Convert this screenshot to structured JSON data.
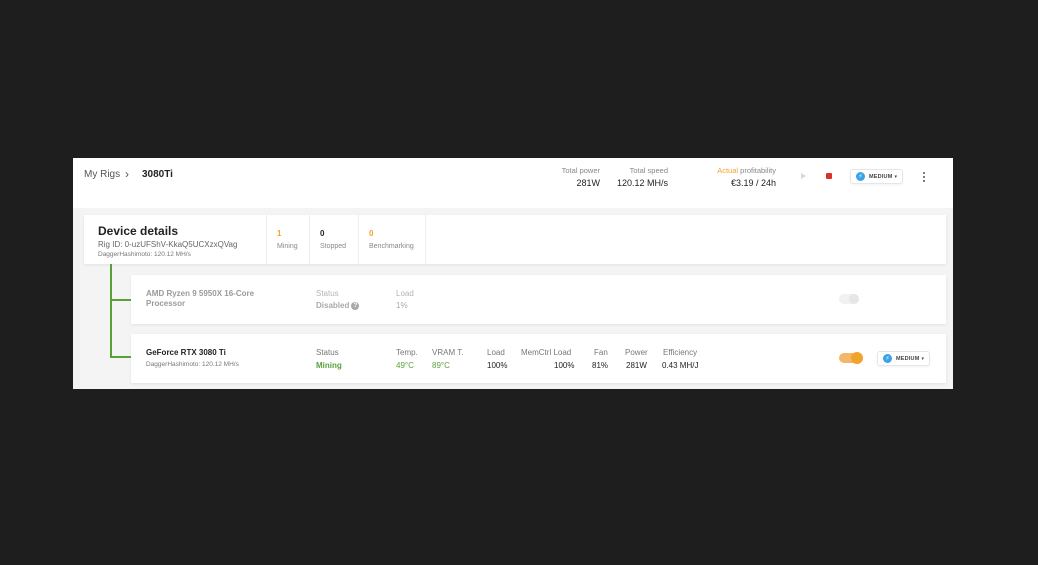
{
  "breadcrumb": {
    "parent": "My Rigs",
    "separator": "›",
    "current": "3080Ti"
  },
  "header_stats": {
    "total_power": {
      "label": "Total power",
      "value": "281W"
    },
    "total_speed": {
      "label": "Total speed",
      "value": "120.12 MH/s"
    },
    "profitability": {
      "label_accent": "Actual",
      "label_rest": " profitability",
      "value": "€3.19 / 24h"
    }
  },
  "controls": {
    "play_icon": "play-icon",
    "stop_icon": "stop-icon",
    "power_mode": "MEDIUM",
    "caret": "▾",
    "bolt": "⚡",
    "menu_icon": "more-vertical-icon"
  },
  "details": {
    "title": "Device details",
    "rig_id": "Rig ID: 0-uzUFShV-KkaQ5UCXzxQVag",
    "algorithm": "DaggerHashimoto: 120.12 MH/s",
    "counts": [
      {
        "num": "1",
        "label": "Mining",
        "color": "#f2a32c"
      },
      {
        "num": "0",
        "label": "Stopped",
        "color": "#222222"
      },
      {
        "num": "0",
        "label": "Benchmarking",
        "color": "#f2a32c"
      }
    ]
  },
  "devices": [
    {
      "name_line1": "AMD Ryzen 9 5950X 16-Core",
      "name_line2": "Processor",
      "status_label": "Status",
      "status_value": "Disabled",
      "help": "?",
      "load_label": "Load",
      "load_value": "1%",
      "enabled": false
    },
    {
      "name": "GeForce RTX 3080 Ti",
      "algorithm": "DaggerHashimoto: 120.12 MH/s",
      "status_label": "Status",
      "status_value": "Mining",
      "metrics": [
        {
          "label": "Temp.",
          "value": "49°C"
        },
        {
          "label": "VRAM T.",
          "value": "89°C"
        },
        {
          "label": "Load",
          "value": "100%"
        },
        {
          "label": "MemCtrl Load",
          "value": "100%"
        },
        {
          "label": "Fan",
          "value": "81%"
        },
        {
          "label": "Power",
          "value": "281W"
        },
        {
          "label": "Efficiency",
          "value": "0.43 MH/J"
        }
      ],
      "power_mode": "MEDIUM",
      "enabled": true
    }
  ],
  "colors": {
    "accent": "#f2a32c",
    "green": "#5aa03a",
    "stop": "#d9322b",
    "bolt": "#3ba3e6"
  }
}
